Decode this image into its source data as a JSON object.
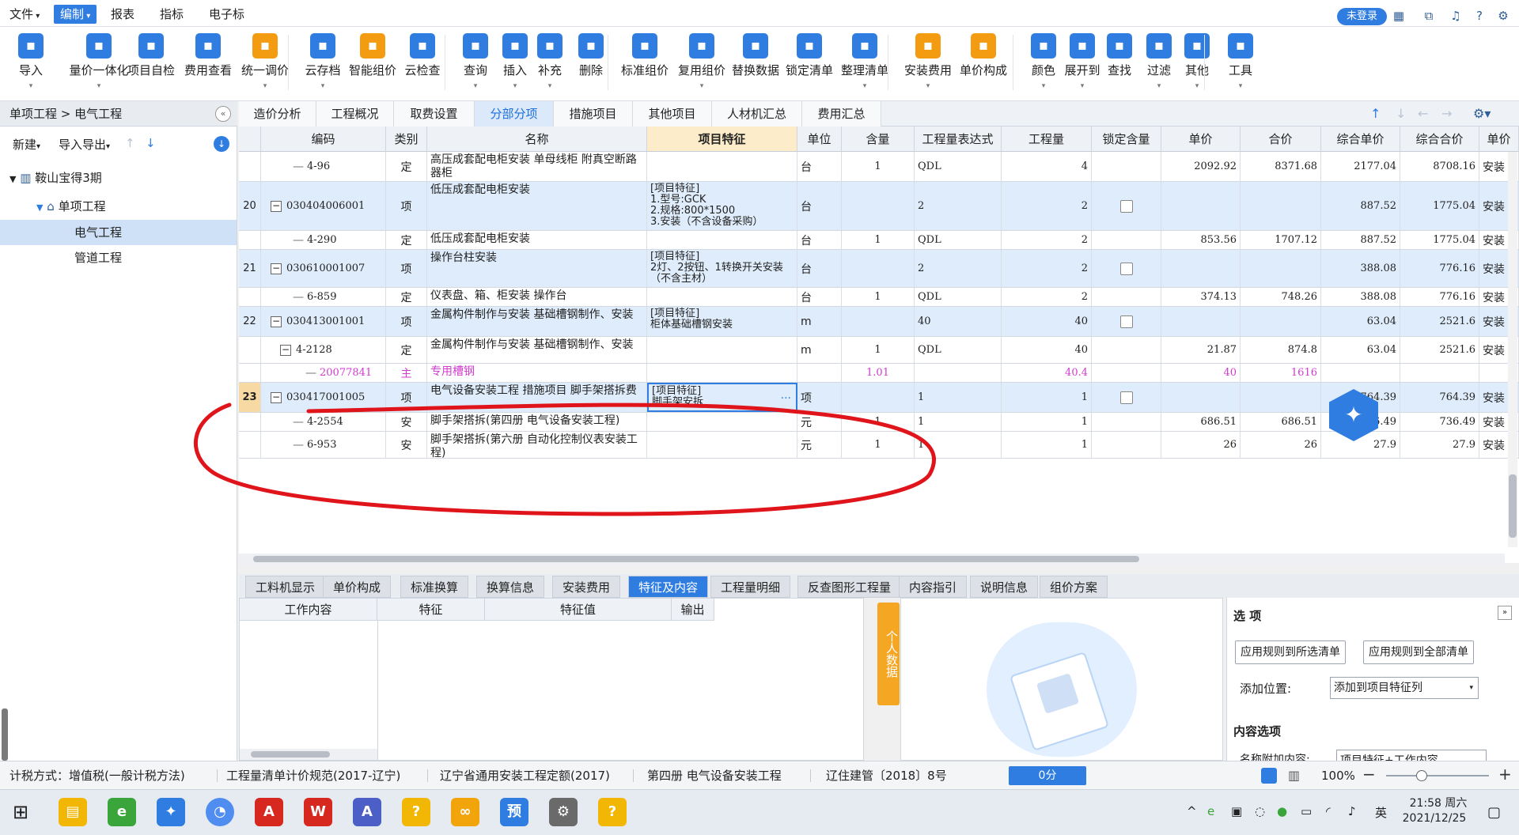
{
  "menu": {
    "file": "文件",
    "edit": "编制",
    "report": "报表",
    "index": "指标",
    "ebid": "电子标"
  },
  "login": "未登录",
  "ribbon": [
    {
      "label": "导入",
      "icon": "import-icon",
      "color": "#2f7de1",
      "arrow": true
    },
    {
      "label": "量价一体化",
      "icon": "quantity-price-icon",
      "color": "#2f7de1",
      "arrow": true
    },
    {
      "label": "项目自检",
      "icon": "project-check-icon",
      "color": "#2f7de1",
      "arrow": false
    },
    {
      "label": "费用查看",
      "icon": "fee-view-icon",
      "color": "#2f7de1",
      "arrow": false
    },
    {
      "label": "统一调价",
      "icon": "price-adjust-icon",
      "color": "#f39c12",
      "arrow": true
    },
    {
      "label": "云存档",
      "icon": "cloud-save-icon",
      "color": "#2f7de1",
      "arrow": true
    },
    {
      "label": "智能组价",
      "icon": "smart-price-icon",
      "color": "#f39c12",
      "arrow": false
    },
    {
      "label": "云检查",
      "icon": "cloud-check-icon",
      "color": "#2f7de1",
      "arrow": false
    },
    {
      "label": "查询",
      "icon": "query-icon",
      "color": "#2f7de1",
      "arrow": true
    },
    {
      "label": "插入",
      "icon": "insert-icon",
      "color": "#2f7de1",
      "arrow": true
    },
    {
      "label": "补充",
      "icon": "supplement-icon",
      "color": "#2f7de1",
      "arrow": true
    },
    {
      "label": "删除",
      "icon": "delete-icon",
      "color": "#2f7de1",
      "arrow": false
    },
    {
      "label": "标准组价",
      "icon": "standard-price-icon",
      "color": "#2f7de1",
      "arrow": false
    },
    {
      "label": "复用组价",
      "icon": "reuse-price-icon",
      "color": "#2f7de1",
      "arrow": true
    },
    {
      "label": "替换数据",
      "icon": "replace-data-icon",
      "color": "#2f7de1",
      "arrow": false
    },
    {
      "label": "锁定清单",
      "icon": "lock-list-icon",
      "color": "#2f7de1",
      "arrow": false
    },
    {
      "label": "整理清单",
      "icon": "arrange-list-icon",
      "color": "#2f7de1",
      "arrow": true
    },
    {
      "label": "安装费用",
      "icon": "install-fee-icon",
      "color": "#f39c12",
      "arrow": true
    },
    {
      "label": "单价构成",
      "icon": "unit-price-icon",
      "color": "#f39c12",
      "arrow": false
    },
    {
      "label": "颜色",
      "icon": "color-icon",
      "color": "#2f7de1",
      "arrow": true
    },
    {
      "label": "展开到",
      "icon": "expand-to-icon",
      "color": "#2f7de1",
      "arrow": true
    },
    {
      "label": "查找",
      "icon": "find-icon",
      "color": "#2f7de1",
      "arrow": false
    },
    {
      "label": "过滤",
      "icon": "filter-icon",
      "color": "#2f7de1",
      "arrow": true
    },
    {
      "label": "其他",
      "icon": "other-icon",
      "color": "#2f7de1",
      "arrow": true
    },
    {
      "label": "工具",
      "icon": "tools-icon",
      "color": "#2f7de1",
      "arrow": true
    }
  ],
  "breadcrumb": "单项工程 > 电气工程",
  "left": {
    "new": "新建",
    "import_export": "导入导出",
    "tree": {
      "root": "鞍山宝得3期",
      "single": "单项工程",
      "electric": "电气工程",
      "pipe": "管道工程"
    }
  },
  "tabs": [
    "造价分析",
    "工程概况",
    "取费设置",
    "分部分项",
    "措施项目",
    "其他项目",
    "人材机汇总",
    "费用汇总"
  ],
  "columns": [
    "编码",
    "类别",
    "名称",
    "项目特征",
    "单位",
    "含量",
    "工程量表达式",
    "工程量",
    "锁定含量",
    "单价",
    "合价",
    "综合单价",
    "综合合价",
    "单价"
  ],
  "rows": [
    {
      "no": "",
      "code": "4-96",
      "type": "定",
      "name": "高压成套配电柜安装 单母线柜 附真空断路器柜",
      "feature": "",
      "unit": "台",
      "content": "1",
      "expr": "QDL",
      "qty": "4",
      "lock": false,
      "price": "2092.92",
      "total": "8371.68",
      "cprice": "2177.04",
      "ctotal": "8708.16",
      "last": "安装"
    },
    {
      "no": "20",
      "code": "030404006001",
      "type": "项",
      "name": "低压成套配电柜安装",
      "feature": "[项目特征]\n1.型号:GCK\n2.规格:800*1500\n3.安装（不含设备采购）",
      "unit": "台",
      "content": "",
      "expr": "2",
      "qty": "2",
      "lock": true,
      "price": "",
      "total": "",
      "cprice": "887.52",
      "ctotal": "1775.04",
      "last": "安装"
    },
    {
      "no": "",
      "code": "4-290",
      "type": "定",
      "name": "低压成套配电柜安装",
      "feature": "",
      "unit": "台",
      "content": "1",
      "expr": "QDL",
      "qty": "2",
      "lock": false,
      "price": "853.56",
      "total": "1707.12",
      "cprice": "887.52",
      "ctotal": "1775.04",
      "last": "安装"
    },
    {
      "no": "21",
      "code": "030610001007",
      "type": "项",
      "name": "操作台柱安装",
      "feature": "[项目特征]\n2灯、2按钮、1转换开关安装（不含主材）",
      "unit": "台",
      "content": "",
      "expr": "2",
      "qty": "2",
      "lock": true,
      "price": "",
      "total": "",
      "cprice": "388.08",
      "ctotal": "776.16",
      "last": "安装"
    },
    {
      "no": "",
      "code": "6-859",
      "type": "定",
      "name": "仪表盘、箱、柜安装 操作台",
      "feature": "",
      "unit": "台",
      "content": "1",
      "expr": "QDL",
      "qty": "2",
      "lock": false,
      "price": "374.13",
      "total": "748.26",
      "cprice": "388.08",
      "ctotal": "776.16",
      "last": "安装"
    },
    {
      "no": "22",
      "code": "030413001001",
      "type": "项",
      "name": "金属构件制作与安装 基础槽钢制作、安装",
      "feature": "[项目特征]\n柜体基础槽钢安装",
      "unit": "m",
      "content": "",
      "expr": "40",
      "qty": "40",
      "lock": true,
      "price": "",
      "total": "",
      "cprice": "63.04",
      "ctotal": "2521.6",
      "last": "安装"
    },
    {
      "no": "",
      "code": "4-2128",
      "type": "定",
      "name": "金属构件制作与安装 基础槽钢制作、安装",
      "feature": "",
      "unit": "m",
      "content": "1",
      "expr": "QDL",
      "qty": "40",
      "lock": false,
      "price": "21.87",
      "total": "874.8",
      "cprice": "63.04",
      "ctotal": "2521.6",
      "last": "安装"
    },
    {
      "no": "",
      "code": "20077841",
      "type": "主",
      "name": "专用槽钢",
      "feature": "",
      "unit": "",
      "content": "1.01",
      "expr": "",
      "qty": "40.4",
      "lock": false,
      "price": "40",
      "total": "1616",
      "cprice": "",
      "ctotal": "",
      "last": ""
    },
    {
      "no": "23",
      "code": "030417001005",
      "type": "项",
      "name": "电气设备安装工程 措施项目 脚手架搭拆费",
      "feature": "[项目特征]\n脚手架安拆",
      "unit": "项",
      "content": "",
      "expr": "1",
      "qty": "1",
      "lock": true,
      "price": "",
      "total": "",
      "cprice": "764.39",
      "ctotal": "764.39",
      "last": "安装"
    },
    {
      "no": "",
      "code": "4-2554",
      "type": "安",
      "name": "脚手架搭拆(第四册 电气设备安装工程)",
      "feature": "",
      "unit": "元",
      "content": "1",
      "expr": "1",
      "qty": "1",
      "lock": false,
      "price": "686.51",
      "total": "686.51",
      "cprice": "736.49",
      "ctotal": "736.49",
      "last": "安装"
    },
    {
      "no": "",
      "code": "6-953",
      "type": "安",
      "name": "脚手架搭拆(第六册 自动化控制仪表安装工程)",
      "feature": "",
      "unit": "元",
      "content": "1",
      "expr": "1",
      "qty": "1",
      "lock": false,
      "price": "26",
      "total": "26",
      "cprice": "27.9",
      "ctotal": "27.9",
      "last": "安装"
    }
  ],
  "bottom_tabs": [
    "工料机显示",
    "单价构成",
    "标准换算",
    "换算信息",
    "安装费用",
    "特征及内容",
    "工程量明细",
    "反查图形工程量",
    "内容指引",
    "说明信息",
    "组价方案"
  ],
  "bottom_columns": [
    "工作内容",
    "特征",
    "特征值",
    "输出"
  ],
  "personal": "个人数据",
  "options": {
    "title": "选 项",
    "apply_selected": "应用规则到所选清单",
    "apply_all": "应用规则到全部清单",
    "add_pos_label": "添加位置:",
    "add_pos_value": "添加到项目特征列",
    "content_options": "内容选项",
    "name_append_label": "名称附加内容:",
    "name_append_value": "项目特征+工作内容"
  },
  "status": {
    "tax": "计税方式：增值税(一般计税方法)",
    "spec": "工程量清单计价规范(2017-辽宁)",
    "quota": "辽宁省通用安装工程定额(2017)",
    "volume": "第四册 电气设备安装工程",
    "doc": "辽住建管〔2018〕8号",
    "score": "0分",
    "zoom": "100%"
  },
  "clock": {
    "time": "21:58 周六",
    "date": "2021/12/25",
    "ime": "英"
  }
}
